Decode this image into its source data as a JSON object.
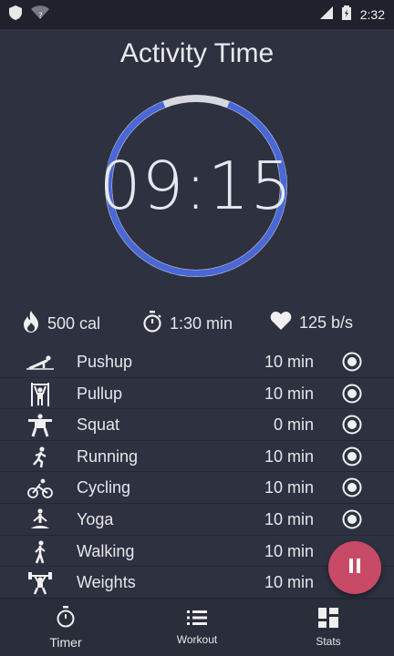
{
  "status_bar": {
    "time": "2:32"
  },
  "title": "Activity Time",
  "timer": {
    "display": "09:15",
    "progress": 0.88
  },
  "stats": {
    "calories": "500 cal",
    "duration": "1:30 min",
    "heart_rate": "125 b/s"
  },
  "activities": [
    {
      "name": "Pushup",
      "duration": "10 min",
      "icon": "pushup-icon"
    },
    {
      "name": "Pullup",
      "duration": "10 min",
      "icon": "pullup-icon"
    },
    {
      "name": "Squat",
      "duration": "0 min",
      "icon": "squat-icon"
    },
    {
      "name": "Running",
      "duration": "10 min",
      "icon": "running-icon"
    },
    {
      "name": "Cycling",
      "duration": "10 min",
      "icon": "cycling-icon"
    },
    {
      "name": "Yoga",
      "duration": "10 min",
      "icon": "yoga-icon"
    },
    {
      "name": "Walking",
      "duration": "10 min",
      "icon": "walking-icon"
    },
    {
      "name": "Weights",
      "duration": "10 min",
      "icon": "weights-icon"
    }
  ],
  "nav": {
    "timer": "Timer",
    "workout": "Workout",
    "stats": "Stats"
  },
  "colors": {
    "background": "#2d3140",
    "ring_track": "#d7d9de",
    "ring_progress": "#4a67d6",
    "fab": "#c94a66"
  }
}
